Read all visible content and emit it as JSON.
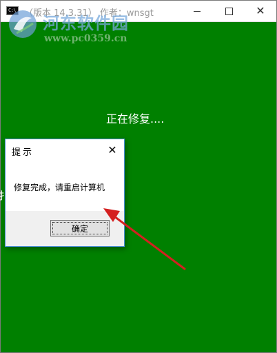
{
  "window": {
    "icon_text": "C:\\",
    "title": "（版本 14.3.31）  作者：wnsgt"
  },
  "watermark": {
    "site_name": "河东软件园",
    "url": "www.pc0359.cn"
  },
  "console": {
    "status_text": "正在修复....",
    "left_edge_glyph": "扌"
  },
  "dialog": {
    "title": "提示",
    "message": "修复完成，请重启计算机",
    "ok_label": "确定"
  },
  "colors": {
    "console_background": "#008000",
    "arrow": "#d42020",
    "dialog_border": "#4a8fd6"
  },
  "icons": {
    "app": "console-icon",
    "minimize": "minimize-icon",
    "maximize": "maximize-icon",
    "close": "close-icon",
    "dialog_close": "close-icon",
    "annotation": "arrow-icon"
  }
}
